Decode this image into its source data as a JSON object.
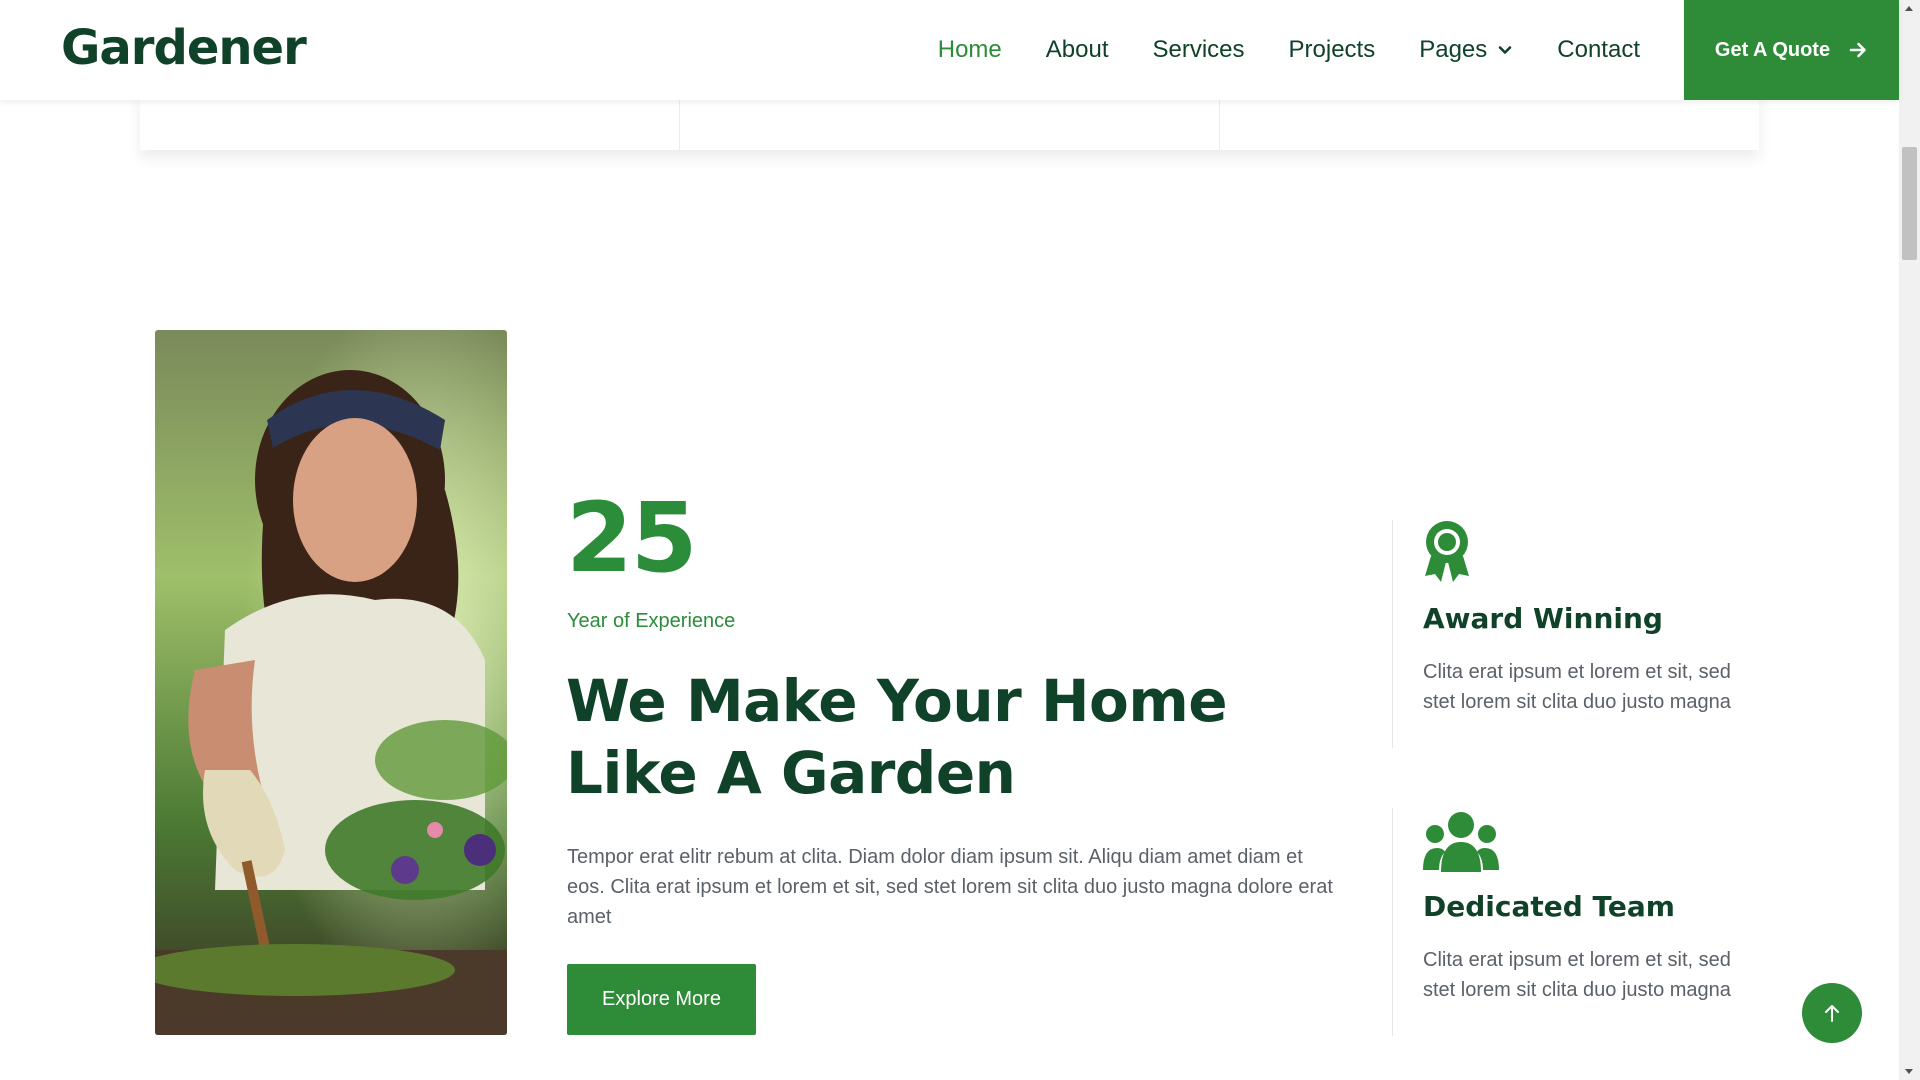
{
  "brand": {
    "name": "Gardener"
  },
  "nav": {
    "items": [
      {
        "label": "Home",
        "active": true
      },
      {
        "label": "About"
      },
      {
        "label": "Services"
      },
      {
        "label": "Projects"
      },
      {
        "label": "Pages",
        "dropdown": true
      },
      {
        "label": "Contact"
      }
    ],
    "cta_label": "Get A Quote",
    "cta_icon": "arrow-right-icon"
  },
  "about": {
    "photo": "woman-gardening-photo",
    "experience_number": "25",
    "experience_label": "Year of Experience",
    "headline": "We Make Your Home Like A Garden",
    "paragraph": "Tempor erat elitr rebum at clita. Diam dolor diam ipsum sit. Aliqu diam amet diam et eos. Clita erat ipsum et lorem et sit, sed stet lorem sit clita duo justo magna dolore erat amet",
    "button_label": "Explore More"
  },
  "features": [
    {
      "icon": "award-icon",
      "title": "Award Winning",
      "text": "Clita erat ipsum et lorem et sit, sed stet lorem sit clita duo justo magna"
    },
    {
      "icon": "team-icon",
      "title": "Dedicated Team",
      "text": "Clita erat ipsum et lorem et sit, sed stet lorem sit clita duo justo magna"
    }
  ],
  "back_to_top_icon": "arrow-up-icon",
  "colors": {
    "primary": "#2e8b37",
    "dark": "#0f4229",
    "text_muted": "#5b6168"
  }
}
